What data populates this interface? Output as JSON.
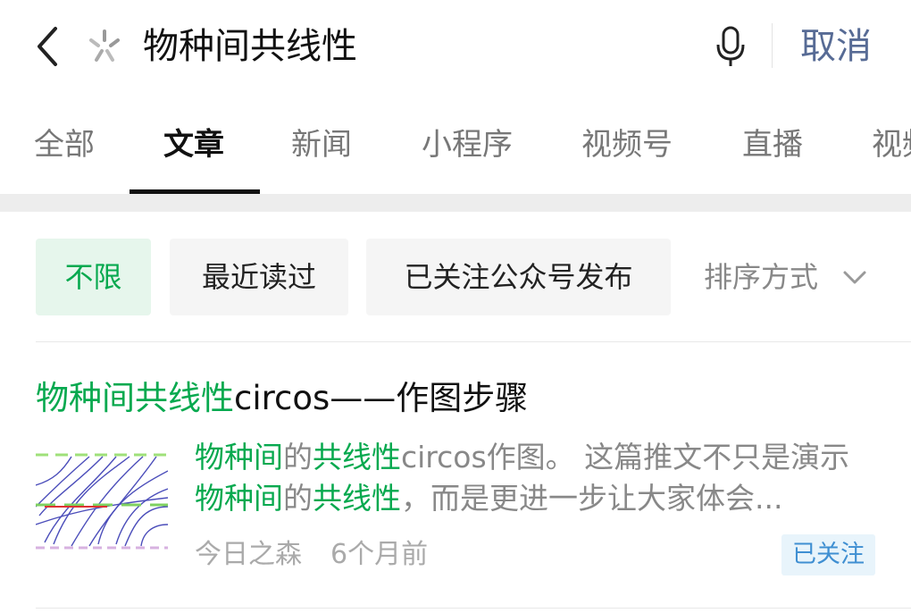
{
  "search": {
    "query": "物种间共线性",
    "cancel_label": "取消"
  },
  "tabs": [
    {
      "label": "全部"
    },
    {
      "label": "文章"
    },
    {
      "label": "新闻"
    },
    {
      "label": "小程序"
    },
    {
      "label": "视频号"
    },
    {
      "label": "直播"
    },
    {
      "label": "视频"
    }
  ],
  "active_tab": "文章",
  "filters": {
    "chips": [
      "不限",
      "最近读过",
      "已关注公众号发布"
    ],
    "sort_label": "排序方式"
  },
  "result": {
    "title_highlight": "物种间共线性",
    "title_rest": "circos——作图步骤",
    "snippet_parts": [
      {
        "text": "物种间",
        "hl": true
      },
      {
        "text": "的",
        "hl": false
      },
      {
        "text": "共线性",
        "hl": true
      },
      {
        "text": "circos作图。 这篇推文不只是演示",
        "hl": false
      },
      {
        "text": "物种间",
        "hl": true
      },
      {
        "text": "的",
        "hl": false
      },
      {
        "text": "共线性",
        "hl": true
      },
      {
        "text": "，而是更进一步让大家体会...",
        "hl": false
      }
    ],
    "source": "今日之森",
    "time": "6个月前",
    "badge": "已关注"
  },
  "colors": {
    "accent": "#07a94f",
    "link": "#576b95",
    "badge_bg": "#e8f4fb",
    "badge_fg": "#3f8fd2"
  }
}
